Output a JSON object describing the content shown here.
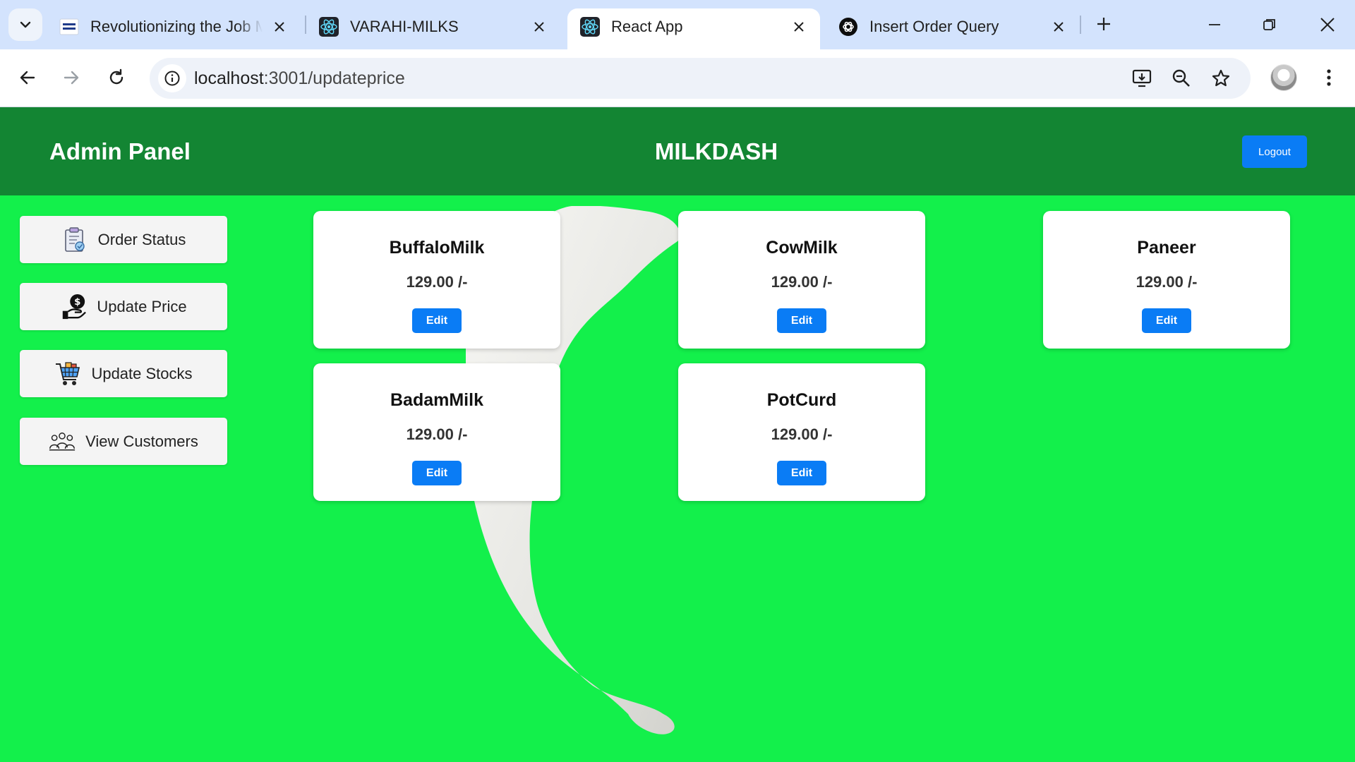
{
  "browser": {
    "tabs": [
      {
        "title": "Revolutionizing the Job M",
        "favicon": "nxt-wave-logo"
      },
      {
        "title": "VARAHI-MILKS",
        "favicon": "react-icon"
      },
      {
        "title": "React App",
        "favicon": "react-icon",
        "active": true
      },
      {
        "title": "Insert Order Query",
        "favicon": "openai-icon"
      }
    ],
    "url_host": "localhost",
    "url_path": ":3001/updateprice"
  },
  "header": {
    "panel_title": "Admin Panel",
    "brand": "MILKDASH",
    "logout_label": "Logout"
  },
  "sidebar": {
    "items": [
      {
        "label": "Order Status",
        "icon": "clipboard-icon"
      },
      {
        "label": "Update Price",
        "icon": "price-tag-icon"
      },
      {
        "label": "Update Stocks",
        "icon": "shopping-cart-icon"
      },
      {
        "label": "View Customers",
        "icon": "customers-icon"
      }
    ]
  },
  "products": [
    {
      "name": "BuffaloMilk",
      "price": "129.00 /-",
      "edit_label": "Edit"
    },
    {
      "name": "CowMilk",
      "price": "129.00 /-",
      "edit_label": "Edit"
    },
    {
      "name": "Paneer",
      "price": "129.00 /-",
      "edit_label": "Edit"
    },
    {
      "name": "BadamMilk",
      "price": "129.00 /-",
      "edit_label": "Edit"
    },
    {
      "name": "PotCurd",
      "price": "129.00 /-",
      "edit_label": "Edit"
    }
  ],
  "colors": {
    "page_bg": "#13f04b",
    "header_bg": "#138533",
    "primary_button": "#0a7cf5"
  }
}
